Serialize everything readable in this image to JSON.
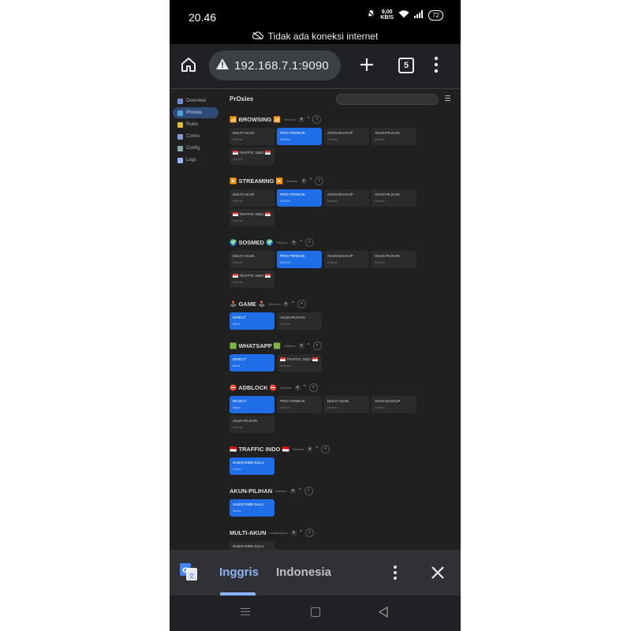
{
  "status": {
    "time": "20.46",
    "net_speed_value": "9,00",
    "net_speed_unit": "KB/S",
    "battery": "72"
  },
  "offline_banner": {
    "text": "Tidak ada koneksi internet"
  },
  "toolbar": {
    "url": "192.168.7.1:9090",
    "tab_count": "5"
  },
  "sidebar": {
    "items": [
      {
        "label": "Overview",
        "color": "#6e8ed8"
      },
      {
        "label": "Proxies",
        "color": "#4aa3df",
        "active": true
      },
      {
        "label": "Rules",
        "color": "#e2b93b"
      },
      {
        "label": "Conns",
        "color": "#7c9bd8"
      },
      {
        "label": "Config",
        "color": "#8aa"
      },
      {
        "label": "Logs",
        "color": "#9ab7ff"
      }
    ]
  },
  "page": {
    "title": "PrOxies"
  },
  "groups": [
    {
      "name": "BROWSING",
      "emoji": "📶",
      "meta": "Selector",
      "cards": [
        {
          "name": "MULTI-AKUN",
          "type": "Selector"
        },
        {
          "name": "PING-TERBAIK",
          "type": "URLTest",
          "selected": true
        },
        {
          "name": "AKUN-BACKUP",
          "type": "Fallback"
        },
        {
          "name": "AKUN-PILIHAN",
          "type": "Selector"
        },
        {
          "name": "TRAFFIC INDO",
          "type": "Selector",
          "flag": true
        }
      ]
    },
    {
      "name": "STREAMING",
      "emoji": "▶️",
      "meta": "Selector",
      "cards": [
        {
          "name": "MULTI-AKUN",
          "type": "Selector"
        },
        {
          "name": "PING-TERBAIK",
          "type": "URLTest",
          "selected": true
        },
        {
          "name": "AKUN-BACKUP",
          "type": "Fallback"
        },
        {
          "name": "AKUN-PILIHAN",
          "type": "Selector"
        },
        {
          "name": "TRAFFIC INDO",
          "type": "Selector",
          "flag": true
        }
      ]
    },
    {
      "name": "SOSMED",
      "emoji": "🌍",
      "meta": "Selector",
      "cards": [
        {
          "name": "MULTI-AKUN",
          "type": "Selector"
        },
        {
          "name": "PING-TERBAIK",
          "type": "URLTest",
          "selected": true
        },
        {
          "name": "AKUN-BACKUP",
          "type": "Fallback"
        },
        {
          "name": "AKUN-PILIHAN",
          "type": "Selector"
        },
        {
          "name": "TRAFFIC INDO",
          "type": "Selector",
          "flag": true
        }
      ]
    },
    {
      "name": "GAME",
      "emoji": "🕹️",
      "meta": "Selector",
      "cards": [
        {
          "name": "DIRECT",
          "type": "Direct",
          "selected": true
        },
        {
          "name": "AKUN-PILIHAN",
          "type": "Selector"
        }
      ]
    },
    {
      "name": "WHATSAPP",
      "emoji": "🟩",
      "meta": "Selector",
      "cards": [
        {
          "name": "DIRECT",
          "type": "Direct",
          "selected": true
        },
        {
          "name": "TRAFFIC INDO",
          "type": "Selector",
          "flag": true
        }
      ]
    },
    {
      "name": "ADBLOCK",
      "emoji": "⛔",
      "meta": "Selector",
      "cards": [
        {
          "name": "REJECT",
          "type": "Reject",
          "selected": true
        },
        {
          "name": "PING-TERBAIK",
          "type": "URLTest"
        },
        {
          "name": "MULTI-AKUN",
          "type": "Selector"
        },
        {
          "name": "AKUN-BACKUP",
          "type": "Fallback"
        },
        {
          "name": "AKUN-PILIHAN",
          "type": "Selector"
        }
      ]
    },
    {
      "name": "TRAFFIC INDO",
      "emoji": "🇮🇩",
      "meta": "Selector",
      "cards": [
        {
          "name": "SUBSCRIBE-DULU",
          "type": "Vmess",
          "selected": true
        }
      ]
    },
    {
      "name": "AKUN-PILIHAN",
      "emoji": "",
      "meta": "Selector",
      "cards": [
        {
          "name": "SUBSCRIBE-DULU",
          "type": "Vmess",
          "selected": true
        }
      ]
    },
    {
      "name": "MULTI-AKUN",
      "emoji": "",
      "meta": "LoadBalance",
      "cards": [
        {
          "name": "SUBSCRIBE-DULU",
          "type": "Vmess"
        }
      ]
    }
  ],
  "translate": {
    "source_lang": "Inggris",
    "target_lang": "Indonesia"
  },
  "colors": {
    "selected_card": "#1f6ee8",
    "link_blue": "#8ab4f8",
    "toolbar_bg": "#202124",
    "content_bg": "#202020"
  },
  "icons": {
    "home": "home-icon",
    "warning": "warning-icon",
    "plus": "plus-icon",
    "tabs": "tabs-icon",
    "menu": "kebab-menu-icon",
    "translate": "google-translate-icon",
    "close": "close-icon"
  }
}
